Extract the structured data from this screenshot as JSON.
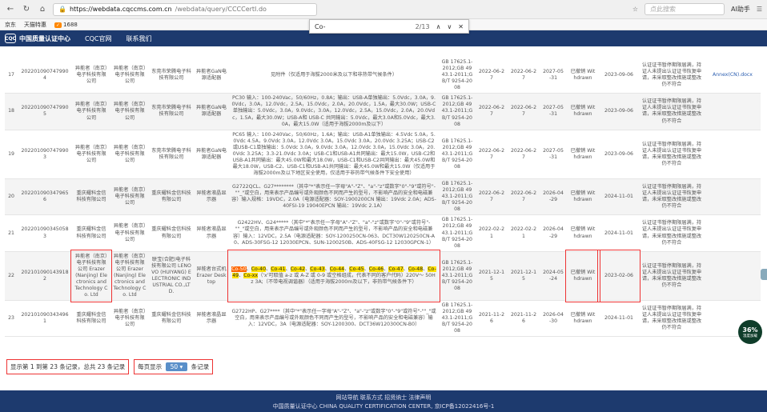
{
  "browser": {
    "url_host": "https://webdata.cqccms.com.cn",
    "url_path": "/webdata/query/CCCCertI.do",
    "search_placeholder": "点此搜索",
    "ai_label": "AI助手"
  },
  "bookmarks": [
    "京东",
    "天猫特惠",
    "1688"
  ],
  "find": {
    "query": "Co-",
    "count": "2/13"
  },
  "site": {
    "logo_text": "中国质量认证中心",
    "nav": [
      "CQC官网",
      "联系我们"
    ]
  },
  "rows": [
    {
      "no": "17",
      "cert": "2022010907479904",
      "applicant": "异能者（南京）电子科技有限公司",
      "maker": "异能者（南京）电子科技有限公司",
      "factory": "东莞市荣腾电子科技有限公司",
      "product": "异能者GaN电源适配器",
      "desc": "见附件（仅适用于海拔2000米及以下和非热带气候条件）",
      "std": "GB 17625.1-2012;GB 4943.1-2011;GB/T 9254-2008",
      "d1": "2022-06-27",
      "d2": "2022-06-27",
      "d3": "2027-05-31",
      "status": "已撤销 Withdrawn",
      "d4": "2023-09-06",
      "reason": "认证证书暂停期限届满，持证人未提出认证证书恢复申请，未采取整改措施或整改仍不符合",
      "extra": "Annex(CN).docx"
    },
    {
      "no": "18",
      "cert": "2022010907479905",
      "applicant": "异能者（南京）电子科技有限公司",
      "maker": "异能者（南京）电子科技有限公司",
      "factory": "东莞市荣腾电子科技有限公司",
      "product": "异能者GaN电源适配器",
      "desc": "PC30 输入：100-240Vac，50/60Hz，0.8A；输出：USB-A单独输出：5.0Vdc，3.0A，9.0Vdc，3.0A，12.0Vdc，2.5A，15.0Vdc，2.0A，20.0Vdc，1.5A，最大30.0W；USB-C单独输出：5.0Vdc，3.0A，9.0Vdc，3.0A，12.0Vdc，2.5A，15.0Vdc，2.0A，20.0Vdc，1.5A，最大30.0W；USB-A和 USB-C 共同输出：5.0Vdc，最大3.0A和5.0Vdc，最大3.0A，最大15.0W（适用于海拔2000m及以下）",
      "std": "GB 17625.1-2012;GB 4943.1-2011;GB/T 9254-2008",
      "d1": "2022-06-27",
      "d2": "2022-06-27",
      "d3": "2027-05-31",
      "status": "已撤销 Withdrawn",
      "d4": "2023-09-06",
      "reason": "认证证书暂停期限届满，持证人未提出认证证书恢复申请，未采取整改措施或整改仍不符合",
      "extra": ""
    },
    {
      "no": "19",
      "cert": "2022010907479903",
      "applicant": "异能者（南京）电子科技有限公司",
      "maker": "异能者（南京）电子科技有限公司",
      "factory": "东莞市荣腾电子科技有限公司",
      "product": "异能者GaN电源适配器",
      "desc": "PC65 输入：100-240Vac，50/60Hz，1.6A；输出：USB-A1单独输出：4.5Vdc 5.0A，5.0Vdc 4.5A，9.0Vdc 3.0A，12.0Vdc 3.0A，15.0Vdc 3.0A，20.0Vdc 3.25A；USB-C2或USB-C1单独输出：5.0Vdc 3.0A，9.0Vdc 3.0A，12.0Vdc 3.0A，15.0Vdc 3.0A，20.0Vdc 3.25A；3.3-21.0Vdc 3.0A；USB-C1和USB-A1共同输出：最大15.0W，USB-C2和USB-A1共同输出：最大45.0W和最大18.0W，USB-C1和USB-C2共同输出：最大45.0W和最大18.0W，USB-C2、USB-C1和USB-A1共同输出：最大45.0W和最大15.0W（仅适用于海拔2000m及以下地区安全使用，仅适用于非热带气候条件下安全使用）",
      "std": "GB 17625.1-2012;GB 4943.1-2011;GB/T 9254-2008",
      "d1": "2022-06-27",
      "d2": "2022-06-27",
      "d3": "2027-05-31",
      "status": "已撤销 Withdrawn",
      "d4": "2023-09-06",
      "reason": "认证证书暂停期限届满，持证人未提出认证证书恢复申请，未采取整改措施或整改仍不符合",
      "extra": ""
    },
    {
      "no": "20",
      "cert": "2022010903479656",
      "applicant": "重庆耀科金信科技有限公司",
      "maker": "异能者（南京）电子科技有限公司",
      "factory": "重庆耀科金信科技有限公司",
      "product": "异能者液晶显示器",
      "desc": "G2722QCL、G27********（其中\"*\"表示任一字母\"A\"-\"Z\"、\"a\"-\"z\"或数字\"0\"-\"9\"或符号\"-\"\"_\"或空白，用来表示产品编号或外观颜色不同而产生的型号，不影响产品的安全和电磁兼容）输入规格：19VDC，2.0A（电源适配器：SOY-1900200CN 输出：19Vdc 2.0A；ADS-40FSI-19 19040EPCN 输出：19Vdc 2.1A）",
      "std": "GB 17625.1-2012;GB 4943.1-2011;GB/T 9254-2008",
      "d1": "2022-06-27",
      "d2": "2022-06-27",
      "d3": "2026-04-29",
      "status": "已撤销 Withdrawn",
      "d4": "2024-11-01",
      "reason": "认证证书暂停期限届满，持证人未提出认证证书恢复申请，未采取整改措施或整改仍不符合",
      "extra": ""
    },
    {
      "no": "21",
      "cert": "2022010903450583",
      "applicant": "重庆耀科金信科技有限公司",
      "maker": "异能者（南京）电子科技有限公司",
      "factory": "重庆耀科金信科技有限公司",
      "product": "异能者液晶显示器",
      "desc": "G2422HV、G24*****（其中\"*\"表示任一字母\"A\"-\"Z\"、\"a\"-\"z\"或数字\"0\"-\"9\"或符号\"-\"\"_\"或空白，用来表示产品编号或外观颜色不同而产生的型号，不影响产品的安全和电磁兼容）输入：12VDC，2.5A（电源适配器：SOY-1200250CN-063、DCT30W120250CN-A0、ADS-30FSG-12 12030EPCN、SUN-1200250B、ADS-40FSG-12 12030GPCN-1）",
      "std": "GB 17625.1-2012;GB 4943.1-2011;GB/T 9254-2008",
      "d1": "2022-02-21",
      "d2": "2022-02-21",
      "d3": "2026-04-29",
      "status": "已撤销 Withdrawn",
      "d4": "2024-11-01",
      "reason": "认证证书暂停期限届满，持证人未提出认证证书恢复申请，未采取整改措施或整改仍不符合",
      "extra": ""
    },
    {
      "no": "22",
      "cert": "2021010901439182",
      "applicant": "异能者（南京）电子科技有限公司 Erazer (Nanjing) Electronics and Technology Co. Ltd",
      "maker": "异能者（南京）电子科技有限公司 Erazer (Nanjing) Electronics and Technology Co. Ltd",
      "factory": "联宝(合肥)电子科技有限公司 LENOVO (HUIYANG) ELECTRONIC INDUSTRIAL CO.,LTD.",
      "product": "异能者台式机 Erazer Desktop",
      "desc_parts": [
        "Co-50",
        "Co-40",
        "Co-41",
        "Co-42",
        "Co-43",
        "Co-44",
        "Co-45",
        "Co-46",
        "Co-47",
        "Co-48",
        "Co-49",
        "Co-xx"
      ],
      "desc_tail": "（'x'可取值 a-z 或 A-Z 或 0-9 或空格组成，代表不同的客户代码）220V～ 50Hz 3A;（不带电视调谐器）（适用于海拔2000m及以下，非热带气候条件下）",
      "std": "GB 17625.1-2012;GB 4943.1-2011;GB/T 9254-2008",
      "d1": "2021-12-15",
      "d2": "2021-12-15",
      "d3": "2024-05-24",
      "status": "已撤销 Withdrawn",
      "d4": "2023-02-06",
      "reason": "认证证书暂停期限届满，持证人未提出认证证书恢复申请，未采取整改措施或整改仍不符合",
      "extra": ""
    },
    {
      "no": "23",
      "cert": "2021010903434961",
      "applicant": "重庆耀科金信科技有限公司",
      "maker": "异能者（南京）电子科技有限公司",
      "factory": "重庆耀科金信科技有限公司",
      "product": "异能者液晶显示器",
      "desc": "G2722HP、G27****（其中\"*\"表示任一字母\"A\"-\"Z\"、\"a\"-\"z\"或数字\"0\"-\"9\"或符号\"-\"\"_\"或空白，用来表示产品编号或外观颜色不同而产生的型号，不影响产品的安全和电磁兼容）输入：12VDC，3A（电源适配器：SOY-1200300、DCT36W120300CN-B0）",
      "std": "GB 17625.1-2012;GB 4943.1-2011;GB/T 9254-2008",
      "d1": "2021-11-26",
      "d2": "2021-11-26",
      "d3": "2026-04-30",
      "status": "已撤销 Withdrawn",
      "d4": "2024-11-01",
      "reason": "认证证书暂停期限届满，持证人未提出认证证书恢复申请，未采取整改措施或整改仍不符合",
      "extra": ""
    }
  ],
  "pager": {
    "summary": "显示第 1 到第 23 条记录，总共 23 条记录",
    "per_page_prefix": "每页显示",
    "per_page_value": "50 ▾",
    "per_page_suffix": "条记录"
  },
  "footer": {
    "links": "网站导航  联系方式  招贤纳士  法律声明",
    "copyright": "中国质量认证中心 CHINA QUALITY CERTIFICATION CENTER, 京ICP备12022416号-1"
  },
  "badge": {
    "percent": "36%",
    "label": "温度加载"
  }
}
